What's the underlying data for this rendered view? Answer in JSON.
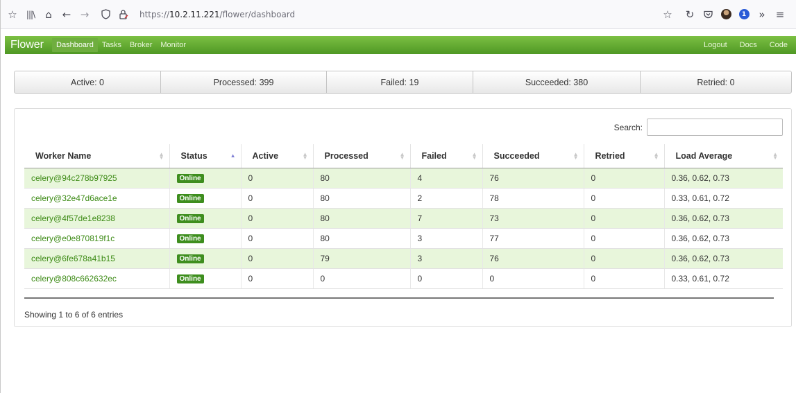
{
  "browser": {
    "url_prefix": "https://",
    "url_host": "10.2.11.221",
    "url_path": "/flower/dashboard"
  },
  "navbar": {
    "brand": "Flower",
    "links": [
      "Dashboard",
      "Tasks",
      "Broker",
      "Monitor"
    ],
    "active": "Dashboard",
    "right_links": [
      "Logout",
      "Docs",
      "Code"
    ]
  },
  "summary": {
    "active": "Active: 0",
    "processed": "Processed: 399",
    "failed": "Failed: 19",
    "succeeded": "Succeeded: 380",
    "retried": "Retried: 0"
  },
  "search": {
    "label": "Search:",
    "value": ""
  },
  "table": {
    "headers": [
      "Worker Name",
      "Status",
      "Active",
      "Processed",
      "Failed",
      "Succeeded",
      "Retried",
      "Load Average"
    ],
    "sorted_column": "Status",
    "rows": [
      {
        "name": "celery@94c278b97925",
        "status": "Online",
        "active": "0",
        "processed": "80",
        "failed": "4",
        "succeeded": "76",
        "retried": "0",
        "load": "0.36, 0.62, 0.73"
      },
      {
        "name": "celery@32e47d6ace1e",
        "status": "Online",
        "active": "0",
        "processed": "80",
        "failed": "2",
        "succeeded": "78",
        "retried": "0",
        "load": "0.33, 0.61, 0.72"
      },
      {
        "name": "celery@4f57de1e8238",
        "status": "Online",
        "active": "0",
        "processed": "80",
        "failed": "7",
        "succeeded": "73",
        "retried": "0",
        "load": "0.36, 0.62, 0.73"
      },
      {
        "name": "celery@e0e870819f1c",
        "status": "Online",
        "active": "0",
        "processed": "80",
        "failed": "3",
        "succeeded": "77",
        "retried": "0",
        "load": "0.36, 0.62, 0.73"
      },
      {
        "name": "celery@6fe678a41b15",
        "status": "Online",
        "active": "0",
        "processed": "79",
        "failed": "3",
        "succeeded": "76",
        "retried": "0",
        "load": "0.36, 0.62, 0.73"
      },
      {
        "name": "celery@808c662632ec",
        "status": "Online",
        "active": "0",
        "processed": "0",
        "failed": "0",
        "succeeded": "0",
        "retried": "0",
        "load": "0.33, 0.61, 0.72"
      }
    ],
    "info": "Showing 1 to 6 of 6 entries"
  },
  "colors": {
    "nav_green": "#5ea72e",
    "row_green": "#e8f6db",
    "badge_green": "#3e8e1e",
    "link_green": "#3d8b16"
  },
  "icons": [
    "bookmarks-icon",
    "library-icon",
    "home-icon",
    "back-icon",
    "forward-icon",
    "shield-icon",
    "lock-icon",
    "star-icon",
    "reload-icon",
    "pocket-icon",
    "avatar-icon",
    "password-manager-icon",
    "overflow-icon",
    "menu-icon"
  ]
}
